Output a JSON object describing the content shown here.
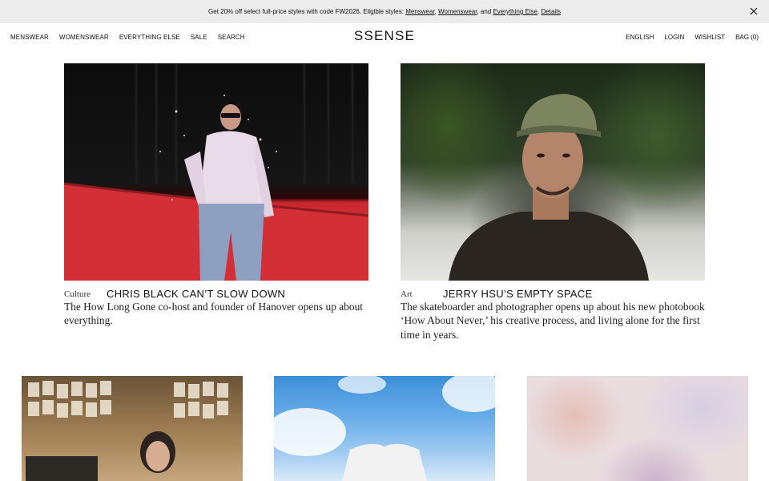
{
  "promo": {
    "prefix": "Get 20% off select full-price styles with code FW2026. Eligible styles: ",
    "menswear": "Menswear",
    "sep1": ", ",
    "womenswear": "Womenswear",
    "sep2": ", and ",
    "everything_else": "Everything Else",
    "sep3": ". ",
    "details": "Details",
    "close_icon": "close-icon"
  },
  "header": {
    "logo": "SSENSE",
    "nav_left": [
      "MENSWEAR",
      "WOMENSWEAR",
      "EVERYTHING ELSE",
      "SALE",
      "SEARCH"
    ],
    "nav_right": [
      "ENGLISH",
      "LOGIN",
      "WISHLIST",
      "BAG (0)"
    ]
  },
  "features": [
    {
      "category": "Culture",
      "title": "CHRIS BLACK CAN’T SLOW DOWN",
      "description": "The How Long Gone co-host and founder of Hanover opens up about everything."
    },
    {
      "category": "Art",
      "title": "JERRY HSU’S EMPTY SPACE",
      "description": "The skateboarder and photographer opens up about his new photobook ‘How About Never,’ his creative process, and living alone for the first time in years."
    }
  ]
}
